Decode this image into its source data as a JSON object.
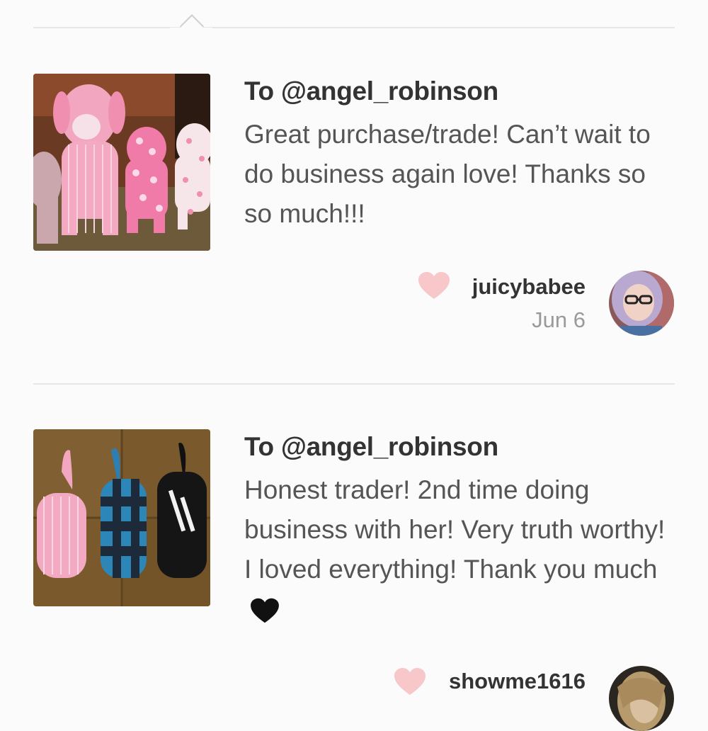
{
  "reviews": [
    {
      "to": "To @angel_robinson",
      "message": "Great purchase/trade! Can’t wait to do business again love! Thanks so so much!!!",
      "username": "juicybabee",
      "date": "Jun 6",
      "heart_color": "#f7c7c9",
      "image": "pink-plush-dogs"
    },
    {
      "to": "To @angel_robinson",
      "message": "Honest trader! 2nd time doing business with her! Very truth worthy! I loved everything! Thank you much",
      "message_emoji": "black-heart-icon",
      "username": "showme1616",
      "date": "",
      "heart_color": "#f7c7c9",
      "image": "plush-dogs-pink-blue-black"
    }
  ],
  "colors": {
    "accent_heart": "#f7c7c9",
    "divider": "#e6e6e6"
  }
}
